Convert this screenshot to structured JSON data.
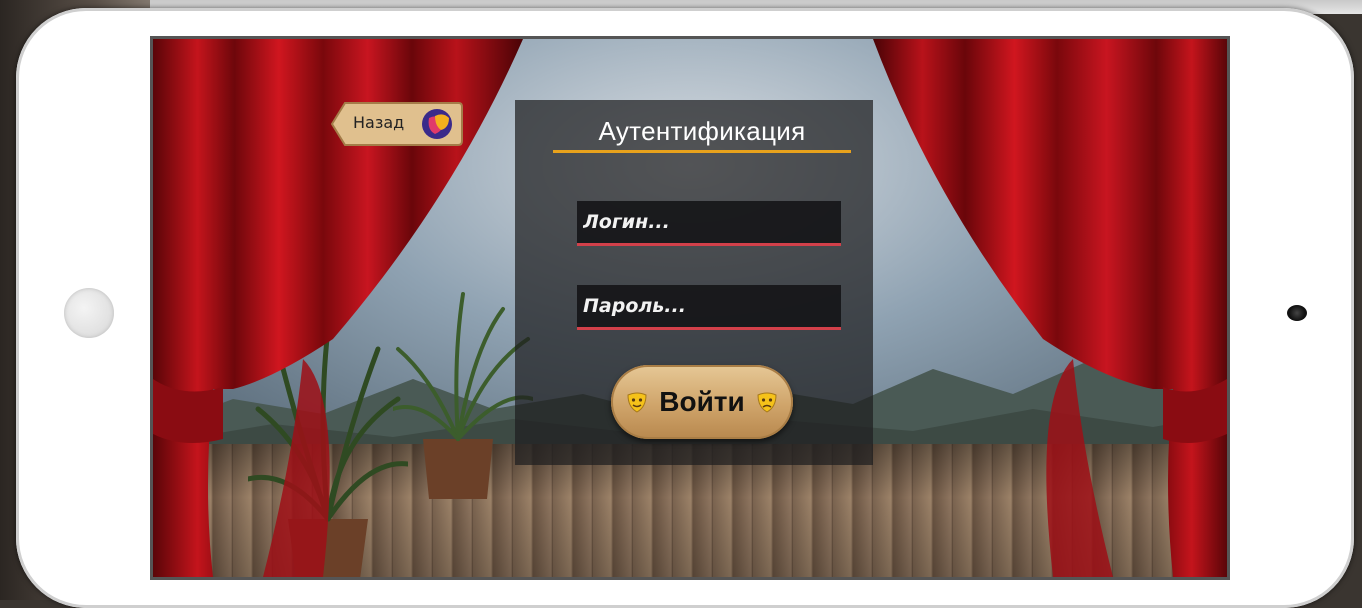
{
  "screen": {
    "back_button": {
      "label": "Назад",
      "icon": "theatre-masks-logo-icon"
    },
    "auth_panel": {
      "title": "Аутентификация",
      "login_field": {
        "value": "",
        "placeholder": "Логин..."
      },
      "password_field": {
        "value": "",
        "placeholder": "Пароль..."
      },
      "submit_button": {
        "label": "Войти",
        "icons": [
          "theater-mask-left-icon",
          "theater-mask-right-icon"
        ]
      }
    }
  },
  "colors": {
    "accent_rule": "#e8a21c",
    "field_underline": "#d2404a",
    "curtain": "#b3121a",
    "wood_button": "#cfa46a"
  }
}
